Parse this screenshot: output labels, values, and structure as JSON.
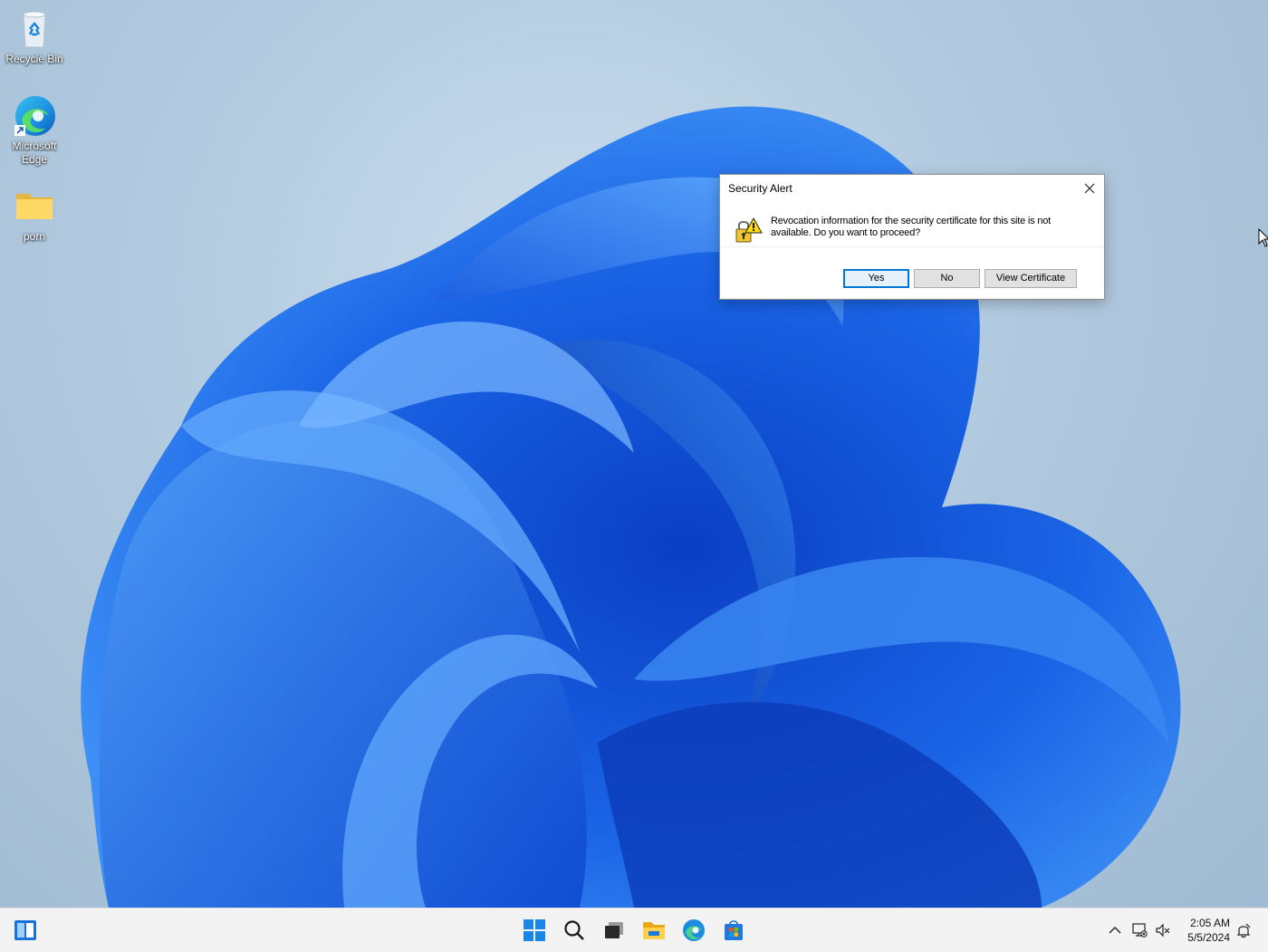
{
  "desktop": {
    "icons": [
      {
        "label": "Recycle Bin"
      },
      {
        "label": "Microsoft Edge"
      },
      {
        "label": "porn"
      }
    ]
  },
  "dialog": {
    "title": "Security Alert",
    "message": "Revocation information for the security certificate for this site is not available.  Do you want to proceed?",
    "buttons": {
      "yes": "Yes",
      "no": "No",
      "view_certificate": "View Certificate"
    }
  },
  "taskbar": {
    "clock": {
      "time": "2:05 AM",
      "date": "5/5/2024"
    }
  }
}
